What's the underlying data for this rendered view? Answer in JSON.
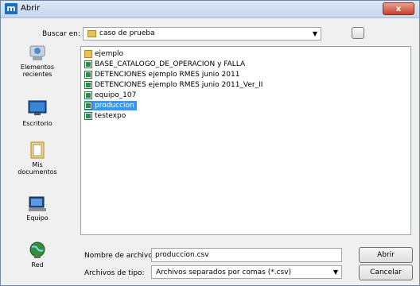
{
  "window": {
    "title": "Abrir",
    "app_icon_letter": "m",
    "close_symbol": "x"
  },
  "lookin": {
    "label": "Buscar en:",
    "value": "caso de prueba",
    "arrow": "▼"
  },
  "places": [
    {
      "id": "recent",
      "label": "Elementos\nrecientes",
      "icon": "recent-places-icon"
    },
    {
      "id": "desktop",
      "label": "Escritorio",
      "icon": "desktop-icon"
    },
    {
      "id": "documents",
      "label": "Mis\ndocumentos",
      "icon": "documents-icon"
    },
    {
      "id": "computer",
      "label": "Equipo",
      "icon": "computer-icon"
    },
    {
      "id": "network",
      "label": "Red",
      "icon": "network-globe-icon"
    }
  ],
  "files": [
    {
      "name": "ejemplo",
      "type": "folder",
      "selected": false
    },
    {
      "name": "BASE_CATALOGO_DE_OPERACION y FALLA",
      "type": "xls",
      "selected": false
    },
    {
      "name": "DETENCIONES ejemplo RMES junio 2011",
      "type": "xls",
      "selected": false
    },
    {
      "name": "DETENCIONES ejemplo RMES junio 2011_Ver_II",
      "type": "xls",
      "selected": false
    },
    {
      "name": "equipo_107",
      "type": "xls",
      "selected": false
    },
    {
      "name": "produccion",
      "type": "xls",
      "selected": true
    },
    {
      "name": "testexpo",
      "type": "xls",
      "selected": false
    }
  ],
  "filename": {
    "label": "Nombre de archivo:",
    "value": "produccion.csv"
  },
  "filetype": {
    "label": "Archivos de tipo:",
    "value": "Archivos separados por comas (*.csv)",
    "arrow": "▼"
  },
  "buttons": {
    "open": "Abrir",
    "cancel": "Cancelar"
  }
}
